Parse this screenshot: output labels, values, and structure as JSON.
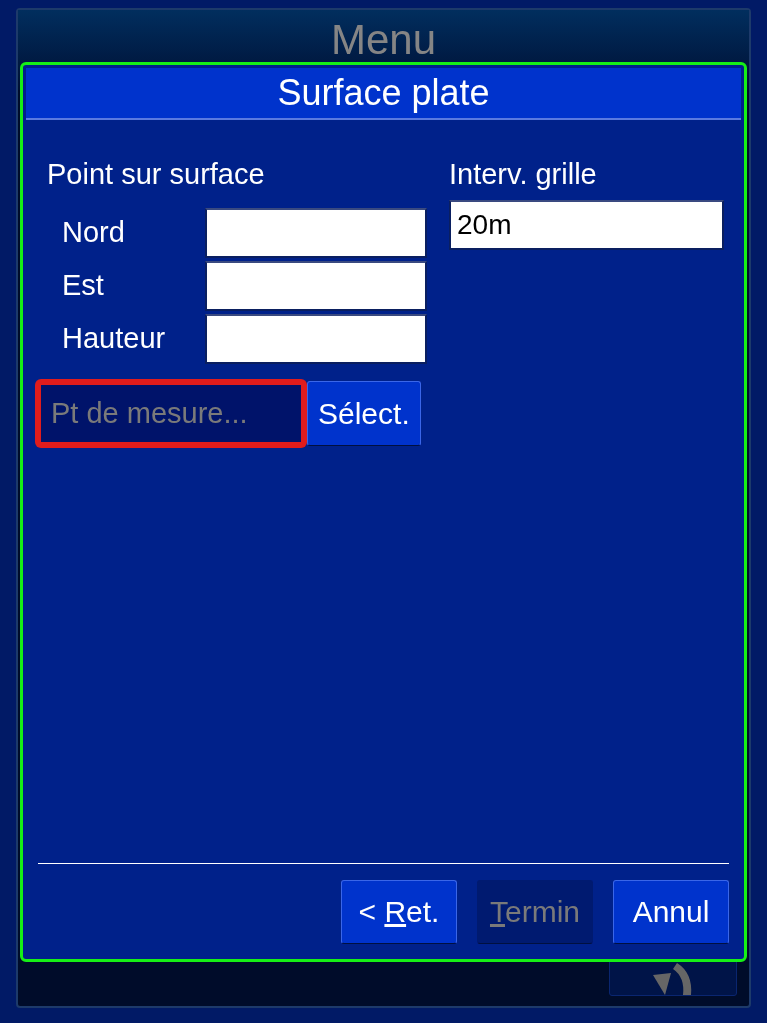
{
  "background_window": {
    "title": "Menu"
  },
  "dialog": {
    "title": "Surface plate",
    "point_section": {
      "heading": "Point sur surface",
      "fields": [
        {
          "label": "Nord"
        },
        {
          "label": "Est"
        },
        {
          "label": "Hauteur"
        }
      ]
    },
    "grid_section": {
      "heading": "Interv. grille",
      "value": "20m"
    },
    "measure_point": {
      "value": "Pt de mesure...",
      "disabled": true,
      "highlighted": true
    },
    "select_button": {
      "label": "Sélect."
    },
    "buttons": [
      {
        "prefix": "< ",
        "accel": "R",
        "rest": "et.",
        "disabled": false
      },
      {
        "accel": "T",
        "rest": "ermin",
        "disabled": true
      },
      {
        "rest": "Annul",
        "disabled": false
      }
    ]
  }
}
